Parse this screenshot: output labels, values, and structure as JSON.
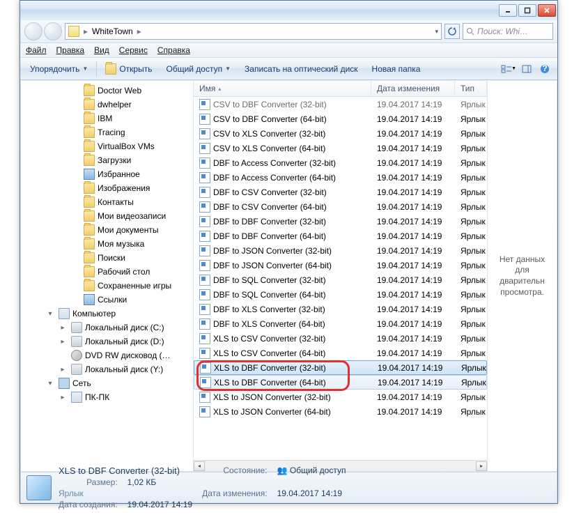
{
  "address": {
    "folder": "WhiteTown"
  },
  "search": {
    "placeholder": "Поиск: Whi…"
  },
  "menu": {
    "file": "Файл",
    "edit": "Правка",
    "view": "Вид",
    "tools": "Сервис",
    "help": "Справка"
  },
  "toolbar": {
    "organize": "Упорядочить",
    "open": "Открыть",
    "share": "Общий доступ",
    "burn": "Записать на оптический диск",
    "newfolder": "Новая папка"
  },
  "tree": [
    {
      "lvl": 3,
      "icon": "fold",
      "label": "Doctor Web"
    },
    {
      "lvl": 3,
      "icon": "fold",
      "label": "dwhelper"
    },
    {
      "lvl": 3,
      "icon": "fold",
      "label": "IBM"
    },
    {
      "lvl": 3,
      "icon": "fold",
      "label": "Tracing"
    },
    {
      "lvl": 3,
      "icon": "fold",
      "label": "VirtualBox VMs"
    },
    {
      "lvl": 3,
      "icon": "fold",
      "label": "Загрузки"
    },
    {
      "lvl": 3,
      "icon": "lib",
      "label": "Избранное"
    },
    {
      "lvl": 3,
      "icon": "fold",
      "label": "Изображения"
    },
    {
      "lvl": 3,
      "icon": "fold",
      "label": "Контакты"
    },
    {
      "lvl": 3,
      "icon": "fold",
      "label": "Мои видеозаписи"
    },
    {
      "lvl": 3,
      "icon": "fold",
      "label": "Мои документы"
    },
    {
      "lvl": 3,
      "icon": "fold",
      "label": "Моя музыка"
    },
    {
      "lvl": 3,
      "icon": "fold",
      "label": "Поиски"
    },
    {
      "lvl": 3,
      "icon": "fold",
      "label": "Рабочий стол"
    },
    {
      "lvl": 3,
      "icon": "fold",
      "label": "Сохраненные игры"
    },
    {
      "lvl": 3,
      "icon": "lib",
      "label": "Ссылки"
    },
    {
      "lvl": 1,
      "icon": "pc",
      "label": "Компьютер",
      "exp": "▾"
    },
    {
      "lvl": 2,
      "icon": "drive",
      "label": "Локальный диск (C:)",
      "exp": "▸"
    },
    {
      "lvl": 2,
      "icon": "drive",
      "label": "Локальный диск (D:)",
      "exp": "▸"
    },
    {
      "lvl": 2,
      "icon": "dvd",
      "label": "DVD RW дисковод (…"
    },
    {
      "lvl": 2,
      "icon": "drive",
      "label": "Локальный диск (Y:)",
      "exp": "▸"
    },
    {
      "lvl": 1,
      "icon": "net",
      "label": "Сеть",
      "exp": "▾"
    },
    {
      "lvl": 2,
      "icon": "pc",
      "label": "ПК-ПК",
      "exp": "▸"
    }
  ],
  "cols": {
    "name": "Имя",
    "date": "Дата изменения",
    "type": "Тип"
  },
  "files": [
    {
      "n": "CSV to DBF Converter (32-bit)",
      "d": "19.04.2017 14:19",
      "t": "Ярлык",
      "dim": true
    },
    {
      "n": "CSV to DBF Converter (64-bit)",
      "d": "19.04.2017 14:19",
      "t": "Ярлык"
    },
    {
      "n": "CSV to XLS Converter (32-bit)",
      "d": "19.04.2017 14:19",
      "t": "Ярлык"
    },
    {
      "n": "CSV to XLS Converter (64-bit)",
      "d": "19.04.2017 14:19",
      "t": "Ярлык"
    },
    {
      "n": "DBF to Access Converter (32-bit)",
      "d": "19.04.2017 14:19",
      "t": "Ярлык"
    },
    {
      "n": "DBF to Access Converter (64-bit)",
      "d": "19.04.2017 14:19",
      "t": "Ярлык"
    },
    {
      "n": "DBF to CSV Converter (32-bit)",
      "d": "19.04.2017 14:19",
      "t": "Ярлык"
    },
    {
      "n": "DBF to CSV Converter (64-bit)",
      "d": "19.04.2017 14:19",
      "t": "Ярлык"
    },
    {
      "n": "DBF to DBF Converter (32-bit)",
      "d": "19.04.2017 14:19",
      "t": "Ярлык"
    },
    {
      "n": "DBF to DBF Converter (64-bit)",
      "d": "19.04.2017 14:19",
      "t": "Ярлык"
    },
    {
      "n": "DBF to JSON Converter (32-bit)",
      "d": "19.04.2017 14:19",
      "t": "Ярлык"
    },
    {
      "n": "DBF to JSON Converter (64-bit)",
      "d": "19.04.2017 14:19",
      "t": "Ярлык"
    },
    {
      "n": "DBF to SQL Converter (32-bit)",
      "d": "19.04.2017 14:19",
      "t": "Ярлык"
    },
    {
      "n": "DBF to SQL Converter (64-bit)",
      "d": "19.04.2017 14:19",
      "t": "Ярлык"
    },
    {
      "n": "DBF to XLS Converter (32-bit)",
      "d": "19.04.2017 14:19",
      "t": "Ярлык"
    },
    {
      "n": "DBF to XLS Converter (64-bit)",
      "d": "19.04.2017 14:19",
      "t": "Ярлык"
    },
    {
      "n": "XLS to CSV Converter (32-bit)",
      "d": "19.04.2017 14:19",
      "t": "Ярлык"
    },
    {
      "n": "XLS to CSV Converter (64-bit)",
      "d": "19.04.2017 14:19",
      "t": "Ярлык"
    },
    {
      "n": "XLS to DBF Converter (32-bit)",
      "d": "19.04.2017 14:19",
      "t": "Ярлык",
      "sel": true
    },
    {
      "n": "XLS to DBF Converter (64-bit)",
      "d": "19.04.2017 14:19",
      "t": "Ярлык",
      "sel2": true
    },
    {
      "n": "XLS to JSON Converter (32-bit)",
      "d": "19.04.2017 14:19",
      "t": "Ярлык"
    },
    {
      "n": "XLS to JSON Converter (64-bit)",
      "d": "19.04.2017 14:19",
      "t": "Ярлык"
    }
  ],
  "preview": "Нет данных для дварительн просмотра.",
  "status": {
    "title": "XLS to DBF Converter (32-bit)",
    "sub": "Ярлык",
    "state_l": "Состояние:",
    "state_v": "Общий доступ",
    "date_l": "Дата изменения:",
    "date_v": "19.04.2017 14:19",
    "size_l": "Размер:",
    "size_v": "1,02 КБ",
    "created_l": "Дата создания:",
    "created_v": "19.04.2017 14:19"
  }
}
